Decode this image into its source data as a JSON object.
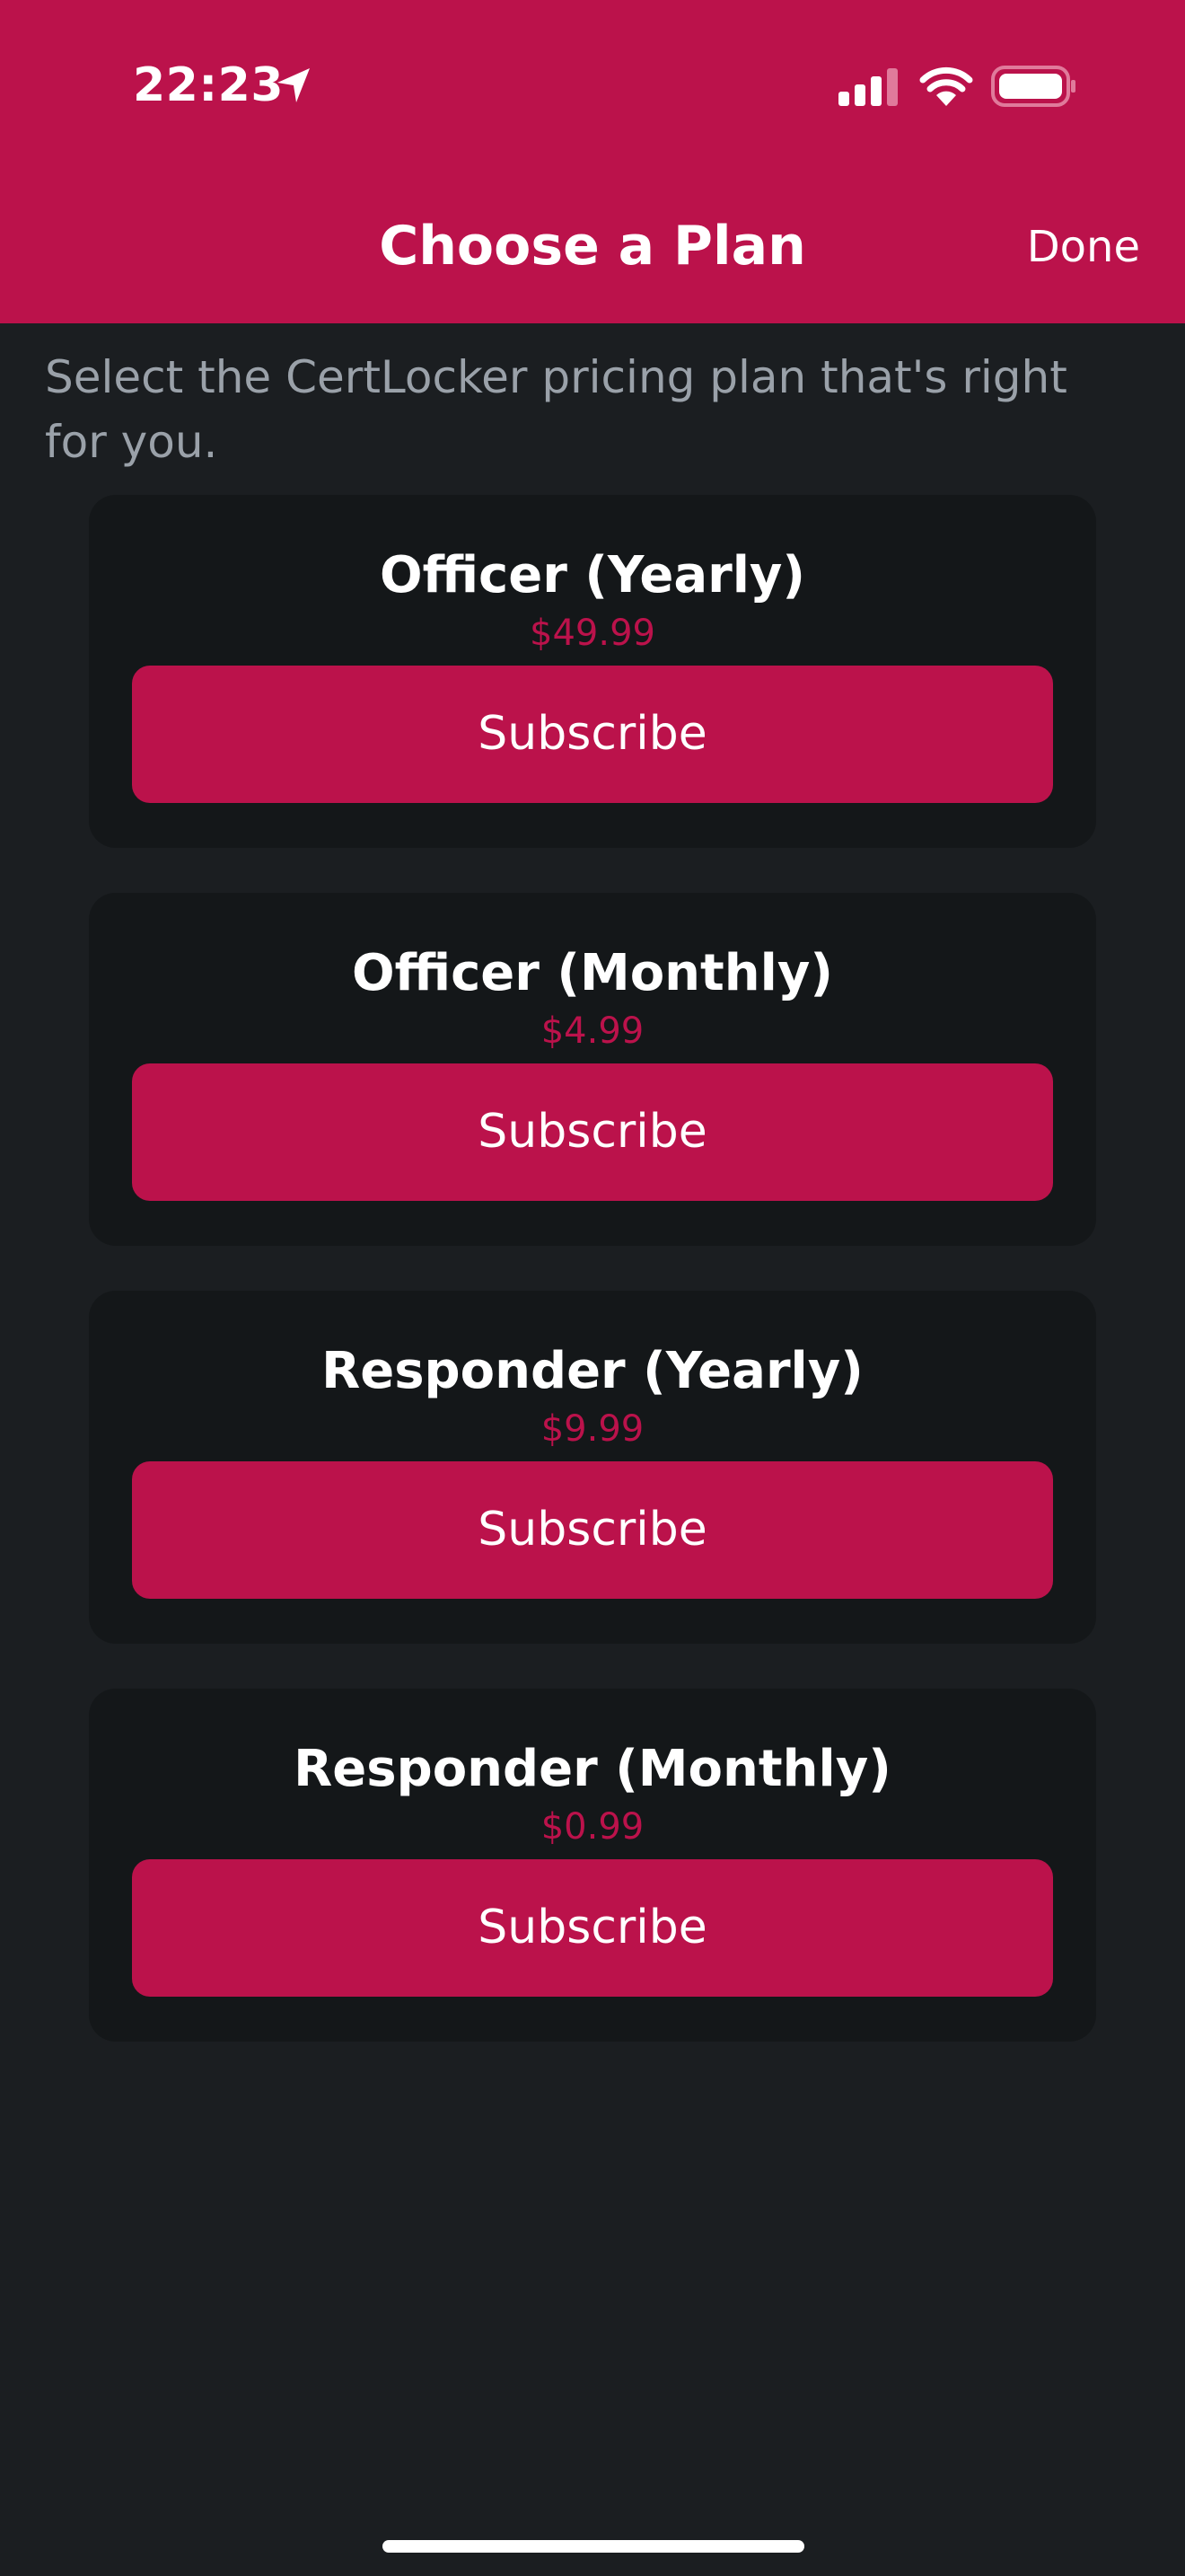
{
  "status_bar": {
    "time": "22:23",
    "icons": [
      "location-arrow-icon",
      "signal-icon",
      "wifi-icon",
      "battery-icon"
    ]
  },
  "nav": {
    "title": "Choose a Plan",
    "done_label": "Done"
  },
  "intro_text": "Select the CertLocker pricing plan that's right for you.",
  "plans": [
    {
      "name": "Officer (Yearly)",
      "price": "$49.99",
      "button_label": "Subscribe"
    },
    {
      "name": "Officer (Monthly)",
      "price": "$4.99",
      "button_label": "Subscribe"
    },
    {
      "name": "Responder (Yearly)",
      "price": "$9.99",
      "button_label": "Subscribe"
    },
    {
      "name": "Responder (Monthly)",
      "price": "$0.99",
      "button_label": "Subscribe"
    }
  ],
  "colors": {
    "accent": "#bb124b",
    "background": "#1b1e21",
    "card": "#141719",
    "muted_text": "#9aa1a9"
  }
}
